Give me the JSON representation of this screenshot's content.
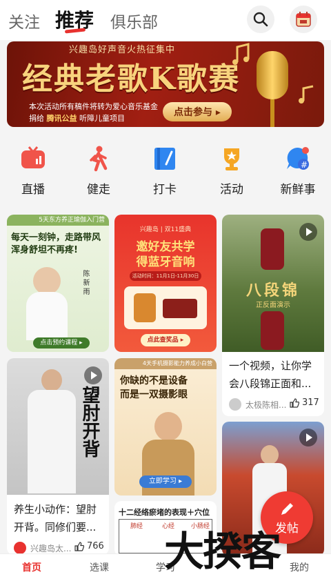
{
  "top_tabs": [
    "关注",
    "推荐",
    "俱乐部"
  ],
  "banner": {
    "subtitle": "兴趣岛好声音火热征集中",
    "title": "经典老歌K歌赛",
    "desc_line1": "本次活动所有稿件将转为爱心音乐基金",
    "desc_line2_pre": "捐给",
    "desc_line2_brand": "腾讯公益",
    "desc_line2_post": "听障儿童项目",
    "button": "点击参与 ▸",
    "slides": 5,
    "current_slide": 4
  },
  "quick_actions": [
    {
      "label": "直播",
      "icon": "live-tv-icon",
      "color": "#f0544a"
    },
    {
      "label": "健走",
      "icon": "walking-person-icon",
      "color": "#f0544a"
    },
    {
      "label": "打卡",
      "icon": "checkin-book-icon",
      "color": "#2f86f0"
    },
    {
      "label": "活动",
      "icon": "trophy-icon",
      "color": "#f5a623"
    },
    {
      "label": "新鲜事",
      "icon": "hashtag-bubble-icon",
      "color": "#2f86f0"
    }
  ],
  "cards": {
    "c1": {
      "top": "5天东方养正瑜伽入门营",
      "headline1": "每天一刻钟，走路带风",
      "headline2": "浑身舒坦不再疼!",
      "name": "陈 新 雨",
      "cta": "点击预约课程 ▸"
    },
    "c2": {
      "brand": "兴趣岛 | 双11盛典",
      "headline1": "邀好友共学",
      "headline2": "得蓝牙音响",
      "date": "活动时间：11月1日-11月30日",
      "cta": "点此查奖品 ▸"
    },
    "c3": {
      "overlay": "八段锦",
      "overlay_sub": "正反面演示",
      "text": "一个视频，让你学会八段锦正面和...",
      "author": "太极陈相...",
      "likes": "317"
    },
    "c4": {
      "overlay": "望肘开背",
      "text": "养生小动作：望肘开背。同修们要...",
      "author": "兴趣岛太...",
      "likes": "766"
    },
    "c5": {
      "top": "4天手机摄影能力养成小白营",
      "headline1": "你缺的不是设备",
      "headline2": "而是一双摄影眼",
      "cta": "立即学习 ▸"
    },
    "c6": {
      "title": "十二经络瘀堵的表现＋穴位",
      "cols": [
        "肺经",
        "心经",
        "小肠经"
      ]
    }
  },
  "fab": {
    "label": "发帖"
  },
  "watermark": "大揆客",
  "bottom_nav": [
    "首页",
    "选课",
    "学习",
    "",
    "我的"
  ]
}
